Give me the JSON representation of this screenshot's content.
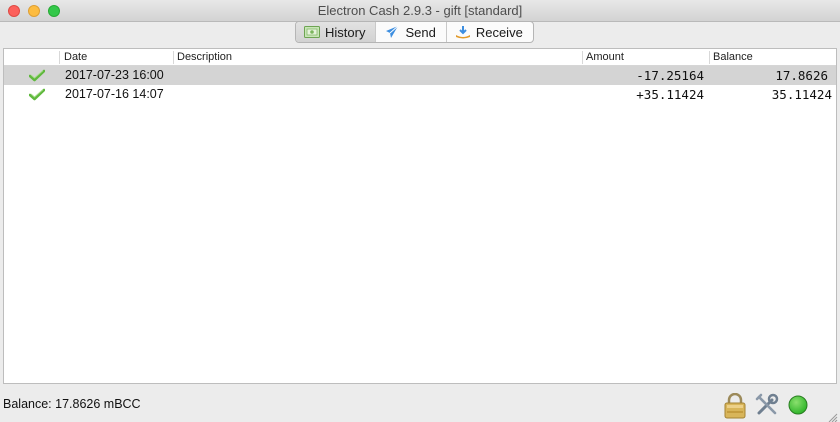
{
  "window": {
    "title": "Electron Cash 2.9.3  -  gift  [standard]"
  },
  "tabs": [
    {
      "label": "History",
      "icon": "history-icon",
      "active": true
    },
    {
      "label": "Send",
      "icon": "send-icon",
      "active": false
    },
    {
      "label": "Receive",
      "icon": "receive-icon",
      "active": false
    }
  ],
  "history": {
    "columns": {
      "date": "Date",
      "description": "Description",
      "amount": "Amount",
      "balance": "Balance"
    },
    "rows": [
      {
        "status": "check-icon",
        "date": "2017-07-23 16:00",
        "description": "",
        "amount": "-17.25164",
        "balance": "17.8626",
        "selected": true
      },
      {
        "status": "check-icon",
        "date": "2017-07-16 14:07",
        "description": "",
        "amount": "+35.11424",
        "balance": "35.11424",
        "selected": false
      }
    ]
  },
  "statusbar": {
    "balance_text": "Balance: 17.8626 mBCC",
    "icons": [
      "lock-icon",
      "preferences-icon",
      "network-status-icon"
    ],
    "network_status_color": "#2fb52a"
  },
  "colors": {
    "selected_row": "#d4d4d4",
    "check_green": "#5fb83d"
  }
}
